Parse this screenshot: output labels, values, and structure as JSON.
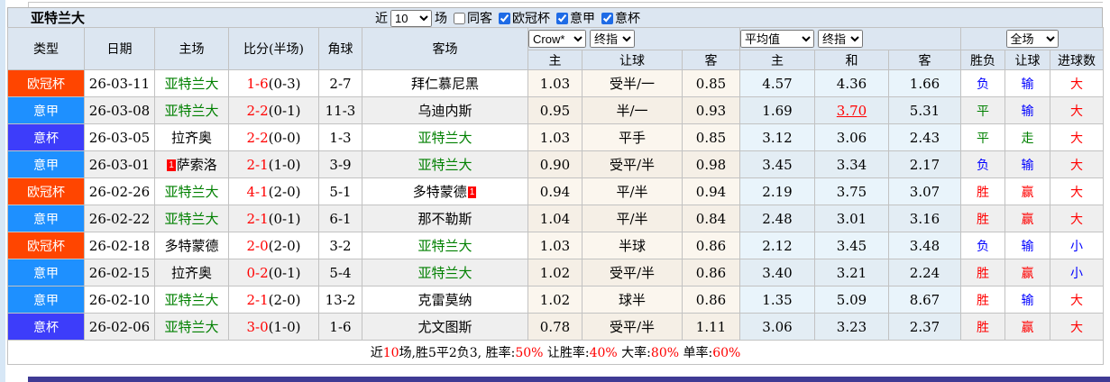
{
  "title": "亚特兰大",
  "filter_bar": {
    "recent_label": "近",
    "count_value": "10",
    "matches_label": "场",
    "checkboxes": [
      {
        "label": "同客",
        "checked": false
      },
      {
        "label": "欧冠杯",
        "checked": true
      },
      {
        "label": "意甲",
        "checked": true
      },
      {
        "label": "意杯",
        "checked": true
      }
    ]
  },
  "odds_selects": {
    "company": "Crow*",
    "company_final": "终指",
    "average": "平均值",
    "average_final": "终指",
    "scope": "全场"
  },
  "table": {
    "left_headers": [
      "类型",
      "日期",
      "主场",
      "比分(半场)",
      "角球",
      "客场"
    ],
    "odds_headers": [
      "主",
      "让球",
      "客",
      "主",
      "和",
      "客"
    ],
    "result_headers": [
      "胜负",
      "让球",
      "进球数"
    ],
    "rows": [
      {
        "league": "欧冠杯",
        "date": "26-03-11",
        "home": {
          "name": "亚特兰大",
          "highlight": true
        },
        "score": "1-6",
        "half": "(0-3)",
        "corners": "2-7",
        "away": {
          "name": "拜仁慕尼黑"
        },
        "asia": [
          "1.03",
          "受半/一",
          "0.85"
        ],
        "euro": [
          "4.57",
          "4.36",
          "1.66"
        ],
        "results": [
          [
            "负",
            "blue"
          ],
          [
            "输",
            "blue"
          ],
          [
            "大",
            "red"
          ]
        ]
      },
      {
        "league": "意甲",
        "date": "26-03-08",
        "home": {
          "name": "亚特兰大",
          "highlight": true
        },
        "score": "2-2",
        "half": "(0-1)",
        "corners": "11-3",
        "away": {
          "name": "乌迪内斯"
        },
        "asia": [
          "0.95",
          "半/一",
          "0.93"
        ],
        "euro": [
          "1.69",
          "3.70",
          "5.31"
        ],
        "euro_marked": 1,
        "results": [
          [
            "平",
            "green"
          ],
          [
            "输",
            "blue"
          ],
          [
            "大",
            "red"
          ]
        ]
      },
      {
        "league": "意杯",
        "date": "26-03-05",
        "home": {
          "name": "拉齐奥"
        },
        "score": "2-2",
        "half": "(0-0)",
        "corners": "1-3",
        "away": {
          "name": "亚特兰大",
          "highlight": true
        },
        "asia": [
          "1.03",
          "平手",
          "0.85"
        ],
        "euro": [
          "3.12",
          "3.06",
          "2.43"
        ],
        "results": [
          [
            "平",
            "green"
          ],
          [
            "走",
            "green"
          ],
          [
            "大",
            "red"
          ]
        ]
      },
      {
        "league": "意甲",
        "date": "26-03-01",
        "home": {
          "name": "萨索洛",
          "badge": "1",
          "badge_pos": "before"
        },
        "score": "2-1",
        "half": "(1-0)",
        "corners": "3-9",
        "away": {
          "name": "亚特兰大",
          "highlight": true
        },
        "asia": [
          "0.90",
          "受平/半",
          "0.98"
        ],
        "euro": [
          "3.45",
          "3.34",
          "2.17"
        ],
        "results": [
          [
            "负",
            "blue"
          ],
          [
            "输",
            "blue"
          ],
          [
            "大",
            "red"
          ]
        ]
      },
      {
        "league": "欧冠杯",
        "date": "26-02-26",
        "home": {
          "name": "亚特兰大",
          "highlight": true
        },
        "score": "4-1",
        "half": "(2-0)",
        "corners": "5-1",
        "away": {
          "name": "多特蒙德",
          "badge": "1",
          "badge_pos": "after"
        },
        "asia": [
          "0.94",
          "平/半",
          "0.94"
        ],
        "euro": [
          "2.19",
          "3.75",
          "3.07"
        ],
        "results": [
          [
            "胜",
            "red"
          ],
          [
            "赢",
            "red"
          ],
          [
            "大",
            "red"
          ]
        ]
      },
      {
        "league": "意甲",
        "date": "26-02-22",
        "home": {
          "name": "亚特兰大",
          "highlight": true
        },
        "score": "2-1",
        "half": "(0-1)",
        "corners": "6-1",
        "away": {
          "name": "那不勒斯"
        },
        "asia": [
          "1.04",
          "平/半",
          "0.84"
        ],
        "euro": [
          "2.48",
          "3.01",
          "3.16"
        ],
        "results": [
          [
            "胜",
            "red"
          ],
          [
            "赢",
            "red"
          ],
          [
            "大",
            "red"
          ]
        ]
      },
      {
        "league": "欧冠杯",
        "date": "26-02-18",
        "home": {
          "name": "多特蒙德"
        },
        "score": "2-0",
        "half": "(2-0)",
        "corners": "3-2",
        "away": {
          "name": "亚特兰大",
          "highlight": true
        },
        "asia": [
          "1.03",
          "半球",
          "0.86"
        ],
        "euro": [
          "2.12",
          "3.45",
          "3.48"
        ],
        "results": [
          [
            "负",
            "blue"
          ],
          [
            "输",
            "blue"
          ],
          [
            "小",
            "blue"
          ]
        ]
      },
      {
        "league": "意甲",
        "date": "26-02-15",
        "home": {
          "name": "拉齐奥"
        },
        "score": "0-2",
        "half": "(0-1)",
        "corners": "5-4",
        "away": {
          "name": "亚特兰大",
          "highlight": true
        },
        "asia": [
          "1.02",
          "受平/半",
          "0.86"
        ],
        "euro": [
          "3.40",
          "3.21",
          "2.24"
        ],
        "results": [
          [
            "胜",
            "red"
          ],
          [
            "赢",
            "red"
          ],
          [
            "小",
            "blue"
          ]
        ]
      },
      {
        "league": "意甲",
        "date": "26-02-10",
        "home": {
          "name": "亚特兰大",
          "highlight": true
        },
        "score": "2-1",
        "half": "(2-0)",
        "corners": "13-2",
        "away": {
          "name": "克雷莫纳"
        },
        "asia": [
          "1.02",
          "球半",
          "0.86"
        ],
        "euro": [
          "1.35",
          "5.09",
          "8.67"
        ],
        "results": [
          [
            "胜",
            "red"
          ],
          [
            "输",
            "blue"
          ],
          [
            "大",
            "red"
          ]
        ]
      },
      {
        "league": "意杯",
        "date": "26-02-06",
        "home": {
          "name": "亚特兰大",
          "highlight": true
        },
        "score": "3-0",
        "half": "(1-0)",
        "corners": "1-6",
        "away": {
          "name": "尤文图斯"
        },
        "asia": [
          "0.78",
          "受平/半",
          "1.11"
        ],
        "euro": [
          "3.06",
          "3.23",
          "2.37"
        ],
        "results": [
          [
            "胜",
            "red"
          ],
          [
            "赢",
            "red"
          ],
          [
            "大",
            "red"
          ]
        ]
      }
    ],
    "summary_parts": [
      [
        "近",
        "black"
      ],
      [
        "10",
        "red"
      ],
      [
        "场,胜5平2负3, ",
        "black"
      ],
      [
        "胜率:",
        "black"
      ],
      [
        "50%",
        "red"
      ],
      [
        " 让胜率:",
        "black"
      ],
      [
        "40%",
        "red"
      ],
      [
        " 大率:",
        "black"
      ],
      [
        "80%",
        "red"
      ],
      [
        " 单率:",
        "black"
      ],
      [
        "60%",
        "red"
      ]
    ]
  },
  "colors": {
    "league": {
      "欧冠杯": "#ff4500",
      "意甲": "#1e90ff",
      "意杯": "#3d3dfa"
    },
    "text": {
      "red": "#ff0000",
      "blue": "#0000ff",
      "green": "#008000",
      "black": "#000000"
    },
    "team_highlight": "#008000",
    "header_bg": "#dce6f1",
    "handicap_col_bg": "#fbf6ee",
    "euro_col_bg": "#e9f4fb",
    "alt_row_bg": "#efefef",
    "bottom_bar": "#3f3a94"
  }
}
